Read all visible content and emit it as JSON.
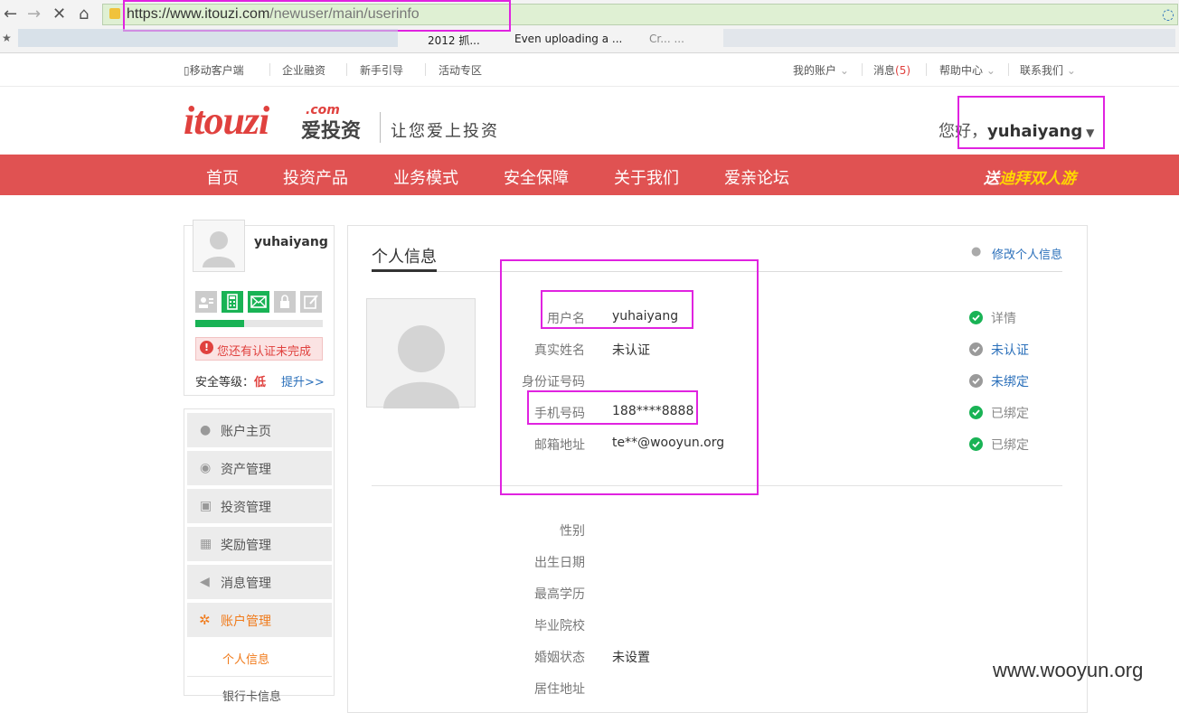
{
  "browser": {
    "url_host": "https://www.itouzi.com",
    "url_path": "/newuser/main/userinfo",
    "bookmarks": [
      "2012 抓...",
      "Even uploading a ...",
      "Cr... ..."
    ]
  },
  "topbar": {
    "mobile": "移动客户端",
    "enterprise": "企业融资",
    "guide": "新手引导",
    "events": "活动专区",
    "my_account": "我的账户",
    "messages": "消息",
    "message_count": "(5)",
    "help": "帮助中心",
    "contact": "联系我们"
  },
  "header": {
    "logo_en": "itouzi",
    "logo_com": ".com",
    "logo_cn": "爱投资",
    "slogan": "让您爱上投资",
    "greeting": "您好，",
    "username": "yuhaiyang"
  },
  "nav": {
    "items": [
      "首页",
      "投资产品",
      "业务模式",
      "安全保障",
      "关于我们",
      "爱亲论坛"
    ],
    "promo_prefix": "送",
    "promo_highlight": "迪拜双人游"
  },
  "sidebar": {
    "username": "yuhaiyang",
    "security_progress": 0.38,
    "warning": "您还有认证未完成",
    "security_level_label": "安全等级：",
    "security_level": "低",
    "upgrade": "提升>>",
    "menu": [
      "账户主页",
      "资产管理",
      "投资管理",
      "奖励管理",
      "消息管理",
      "账户管理"
    ],
    "sub_menu": [
      "个人信息",
      "银行卡信息"
    ]
  },
  "panel": {
    "title": "个人信息",
    "edit_link": "修改个人信息",
    "fields": [
      {
        "label": "用户名",
        "value": "yuhaiyang",
        "status": "详情",
        "status_type": "ok"
      },
      {
        "label": "真实姓名",
        "value": "未认证",
        "status": "未认证",
        "status_type": "pending"
      },
      {
        "label": "身份证号码",
        "value": "",
        "status": "未绑定",
        "status_type": "pending"
      },
      {
        "label": "手机号码",
        "value": "188****8888",
        "status": "已绑定",
        "status_type": "ok"
      },
      {
        "label": "邮箱地址",
        "value": "te**@wooyun.org",
        "status": "已绑定",
        "status_type": "ok"
      }
    ],
    "extra_fields": [
      {
        "label": "性别",
        "value": ""
      },
      {
        "label": "出生日期",
        "value": ""
      },
      {
        "label": "最高学历",
        "value": ""
      },
      {
        "label": "毕业院校",
        "value": ""
      },
      {
        "label": "婚姻状态",
        "value": "未设置"
      },
      {
        "label": "居住地址",
        "value": ""
      }
    ]
  },
  "watermark": "www.wooyun.org",
  "colors": {
    "brand_red": "#e05252",
    "highlight_magenta": "#e023e0",
    "ok_green": "#19b355",
    "link_blue": "#2a6fba"
  }
}
